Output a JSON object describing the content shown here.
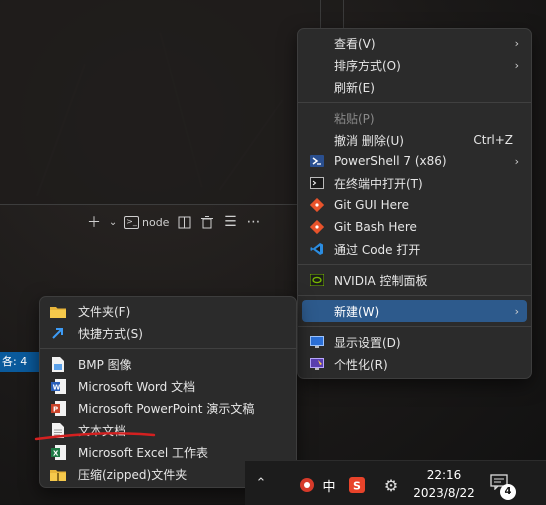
{
  "terminal": {
    "toolbar_profile": "node",
    "status_left": "各: 4"
  },
  "context_menu": {
    "items": [
      {
        "label": "查看(V)",
        "icon": "none",
        "submenu": true
      },
      {
        "label": "排序方式(O)",
        "icon": "none",
        "submenu": true
      },
      {
        "label": "刷新(E)",
        "icon": "none"
      },
      {
        "label": "粘贴(P)",
        "icon": "none",
        "disabled": true
      },
      {
        "label": "撤消 删除(U)",
        "icon": "none",
        "shortcut": "Ctrl+Z"
      },
      {
        "label": "PowerShell 7 (x86)",
        "icon": "powershell-icon",
        "submenu": true
      },
      {
        "label": "在终端中打开(T)",
        "icon": "terminal-icon"
      },
      {
        "label": "Git GUI Here",
        "icon": "git-gui-icon"
      },
      {
        "label": "Git Bash Here",
        "icon": "git-bash-icon"
      },
      {
        "label": "通过 Code 打开",
        "icon": "vscode-icon"
      },
      {
        "label": "NVIDIA 控制面板",
        "icon": "nvidia-icon"
      },
      {
        "label": "新建(W)",
        "icon": "none",
        "submenu": true,
        "highlighted": true
      },
      {
        "label": "显示设置(D)",
        "icon": "display-settings-icon"
      },
      {
        "label": "个性化(R)",
        "icon": "personalize-icon"
      }
    ]
  },
  "new_submenu": {
    "items": [
      {
        "label": "文件夹(F)",
        "icon": "folder-icon"
      },
      {
        "label": "快捷方式(S)",
        "icon": "shortcut-icon"
      },
      {
        "label": "BMP 图像",
        "icon": "bmp-image-icon"
      },
      {
        "label": "Microsoft Word 文档",
        "icon": "word-icon"
      },
      {
        "label": "Microsoft PowerPoint 演示文稿",
        "icon": "powerpoint-icon"
      },
      {
        "label": "文本文档",
        "icon": "text-document-icon"
      },
      {
        "label": "Microsoft Excel 工作表",
        "icon": "excel-icon"
      },
      {
        "label": "压缩(zipped)文件夹",
        "icon": "zip-folder-icon"
      }
    ]
  },
  "taskbar": {
    "ime_label": "中",
    "time": "22:16",
    "date": "2023/8/22",
    "notification_count": "4"
  },
  "colors": {
    "menu_bg": "#2b2b2b",
    "highlight": "#2d5a8c",
    "annotation": "#d42020"
  }
}
